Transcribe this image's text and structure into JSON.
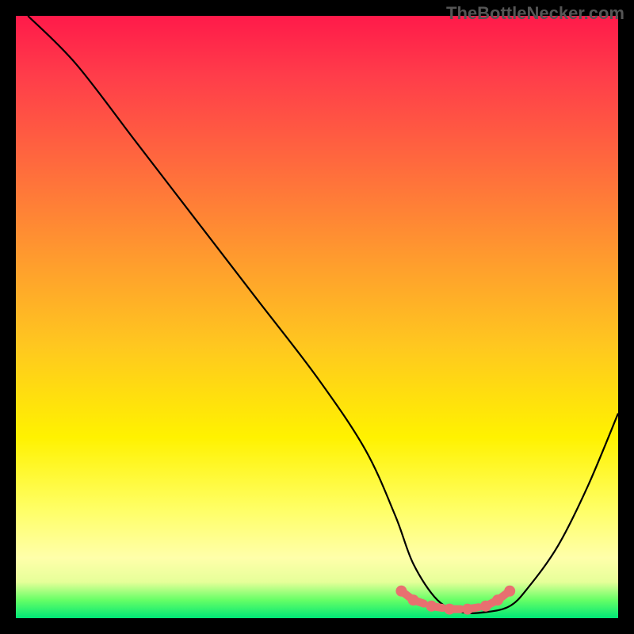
{
  "watermark": "TheBottleNecker.com",
  "chart_data": {
    "type": "line",
    "title": "",
    "xlabel": "",
    "ylabel": "",
    "xlim": [
      0,
      100
    ],
    "ylim": [
      0,
      100
    ],
    "series": [
      {
        "name": "curve",
        "x": [
          2,
          10,
          20,
          30,
          40,
          50,
          58,
          63,
          66,
          70,
          74,
          78,
          82,
          85,
          90,
          95,
          100
        ],
        "y": [
          100,
          92,
          79,
          66,
          53,
          40,
          28,
          17,
          9,
          3,
          1,
          1,
          2,
          5,
          12,
          22,
          34
        ]
      }
    ],
    "markers": {
      "name": "optimal-range",
      "x": [
        64,
        66,
        69,
        72,
        75,
        78,
        80,
        82
      ],
      "y": [
        4.5,
        3,
        2,
        1.5,
        1.5,
        2,
        3,
        4.5
      ]
    },
    "gradient_stops": [
      {
        "pos": 0,
        "color": "#ff1a4a"
      },
      {
        "pos": 25,
        "color": "#ff6b3d"
      },
      {
        "pos": 55,
        "color": "#ffc81f"
      },
      {
        "pos": 82,
        "color": "#ffff66"
      },
      {
        "pos": 97,
        "color": "#66ff66"
      },
      {
        "pos": 100,
        "color": "#00e676"
      }
    ]
  }
}
